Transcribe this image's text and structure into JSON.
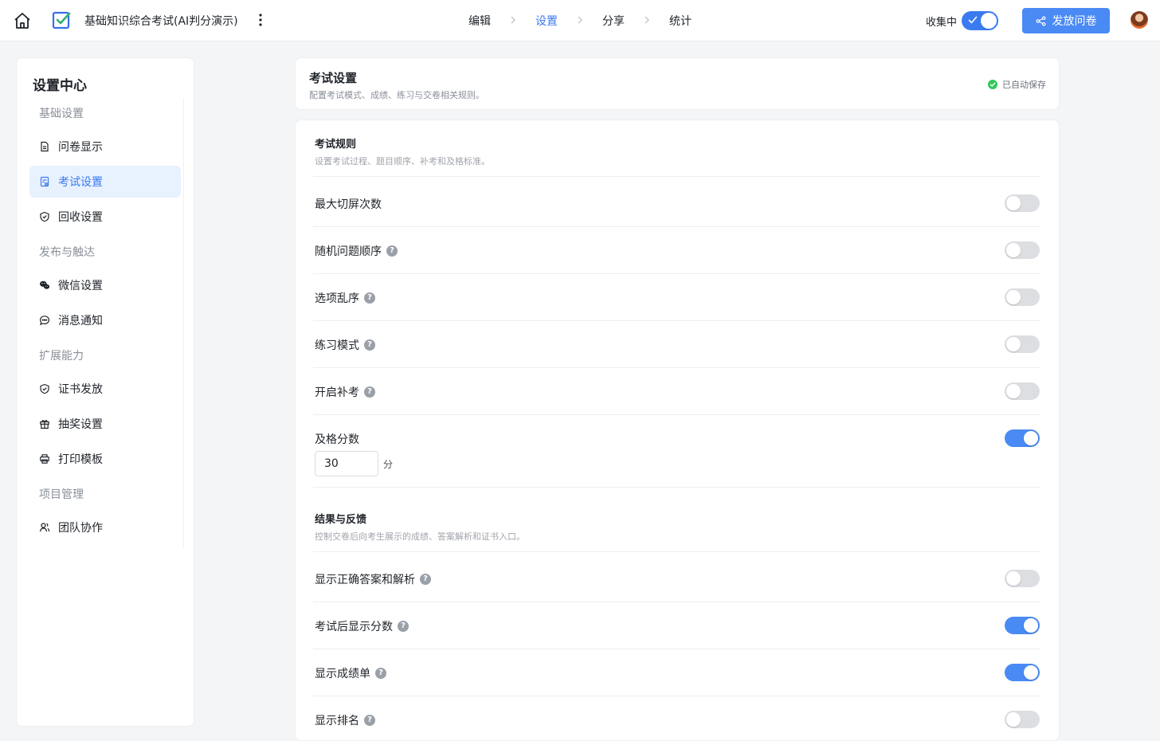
{
  "topbar": {
    "title": "基础知识综合考试(AI判分演示)",
    "steps": [
      "编辑",
      "设置",
      "分享",
      "统计"
    ],
    "active_step": "设置",
    "collect_label": "收集中",
    "collect_on": true,
    "publish_label": "发放问卷",
    "accent": "#3b7bef"
  },
  "sidebar": {
    "title": "设置中心",
    "groups": {
      "basic": "基础设置",
      "publish": "发布与触达",
      "extend": "扩展能力",
      "project": "项目管理"
    },
    "items": [
      {
        "label": "问卷显示",
        "icon": "document-icon"
      },
      {
        "label": "考试设置",
        "icon": "exam-icon",
        "active": true
      },
      {
        "label": "回收设置",
        "icon": "shield-icon"
      },
      {
        "label": "微信设置",
        "icon": "wechat-icon"
      },
      {
        "label": "消息通知",
        "icon": "chat-bubble-icon"
      },
      {
        "label": "证书发放",
        "icon": "certificate-shield-icon"
      },
      {
        "label": "抽奖设置",
        "icon": "gift-icon"
      },
      {
        "label": "打印模板",
        "icon": "printer-icon"
      },
      {
        "label": "团队协作",
        "icon": "team-icon"
      }
    ]
  },
  "header": {
    "title": "考试设置",
    "subtitle": "配置考试模式、成绩、练习与交卷相关规则。",
    "saved_label": "已自动保存"
  },
  "rules": {
    "title": "考试规则",
    "desc": "设置考试过程、题目顺序、补考和及格标准。",
    "rows": [
      {
        "label": "最大切屏次数",
        "help": false,
        "on": false
      },
      {
        "label": "随机问题顺序",
        "help": true,
        "on": false
      },
      {
        "label": "选项乱序",
        "help": true,
        "on": false
      },
      {
        "label": "练习模式",
        "help": true,
        "on": false
      },
      {
        "label": "开启补考",
        "help": true,
        "on": false
      },
      {
        "label": "及格分数",
        "help": false,
        "on": true
      }
    ],
    "pass_score": "30",
    "pass_unit": "分"
  },
  "results": {
    "title": "结果与反馈",
    "desc": "控制交卷后向考生展示的成绩、答案解析和证书入口。",
    "rows": [
      {
        "label": "显示正确答案和解析",
        "help": true,
        "on": false
      },
      {
        "label": "考试后显示分数",
        "help": true,
        "on": true
      },
      {
        "label": "显示成绩单",
        "help": true,
        "on": true
      },
      {
        "label": "显示排名",
        "help": true,
        "on": false
      }
    ]
  }
}
